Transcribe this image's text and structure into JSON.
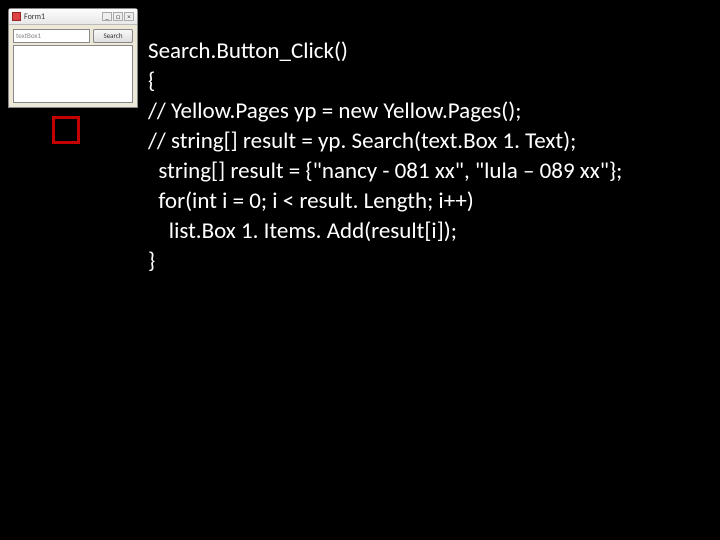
{
  "window": {
    "title": "Form1",
    "textbox_placeholder": "textBox1",
    "button_label": "Search",
    "min": "_",
    "max": "□",
    "close": "×"
  },
  "code": {
    "l1": "Search.Button_Click()",
    "l2": "{",
    "l3": "// Yellow.Pages yp = new Yellow.Pages();",
    "l4": "// string[] result = yp. Search(text.Box 1. Text);",
    "l5": "  string[] result = {\"nancy - 081 xx\", \"lula – 089 xx\"};",
    "l6": "  for(int i = 0; i < result. Length; i++)",
    "l7": "    list.Box 1. Items. Add(result[i]);",
    "l8": "}"
  }
}
